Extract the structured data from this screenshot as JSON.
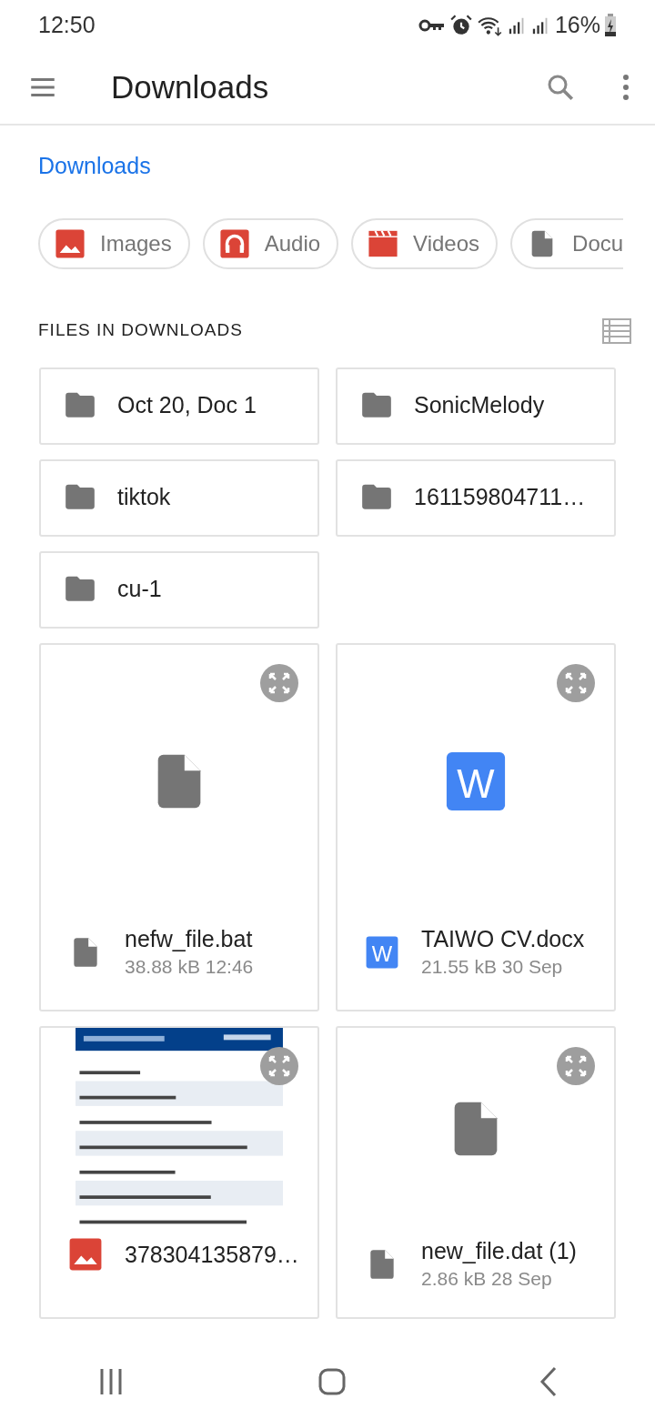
{
  "status_bar": {
    "time": "12:50",
    "battery": "16%"
  },
  "app_bar": {
    "title": "Downloads"
  },
  "breadcrumb": "Downloads",
  "chips": [
    {
      "label": "Images",
      "kind": "image"
    },
    {
      "label": "Audio",
      "kind": "audio"
    },
    {
      "label": "Videos",
      "kind": "video"
    },
    {
      "label": "Docu",
      "kind": "document"
    }
  ],
  "section_title": "FILES IN DOWNLOADS",
  "folders": [
    {
      "name": "Oct 20, Doc 1"
    },
    {
      "name": "SonicMelody"
    },
    {
      "name": "tiktok"
    },
    {
      "name": "161159804711…"
    },
    {
      "name": "cu-1"
    }
  ],
  "files": [
    {
      "name": "nefw_file.bat",
      "meta": "38.88 kB 12:46",
      "kind": "file"
    },
    {
      "name": "TAIWO CV.docx",
      "meta": "21.55 kB 30 Sep",
      "kind": "word",
      "preview_letter": "W",
      "icon_letter": "W"
    },
    {
      "name": "378304135879…",
      "kind": "image"
    },
    {
      "name": "new_file.dat (1)",
      "meta": "2.86 kB 28 Sep",
      "kind": "file"
    }
  ]
}
